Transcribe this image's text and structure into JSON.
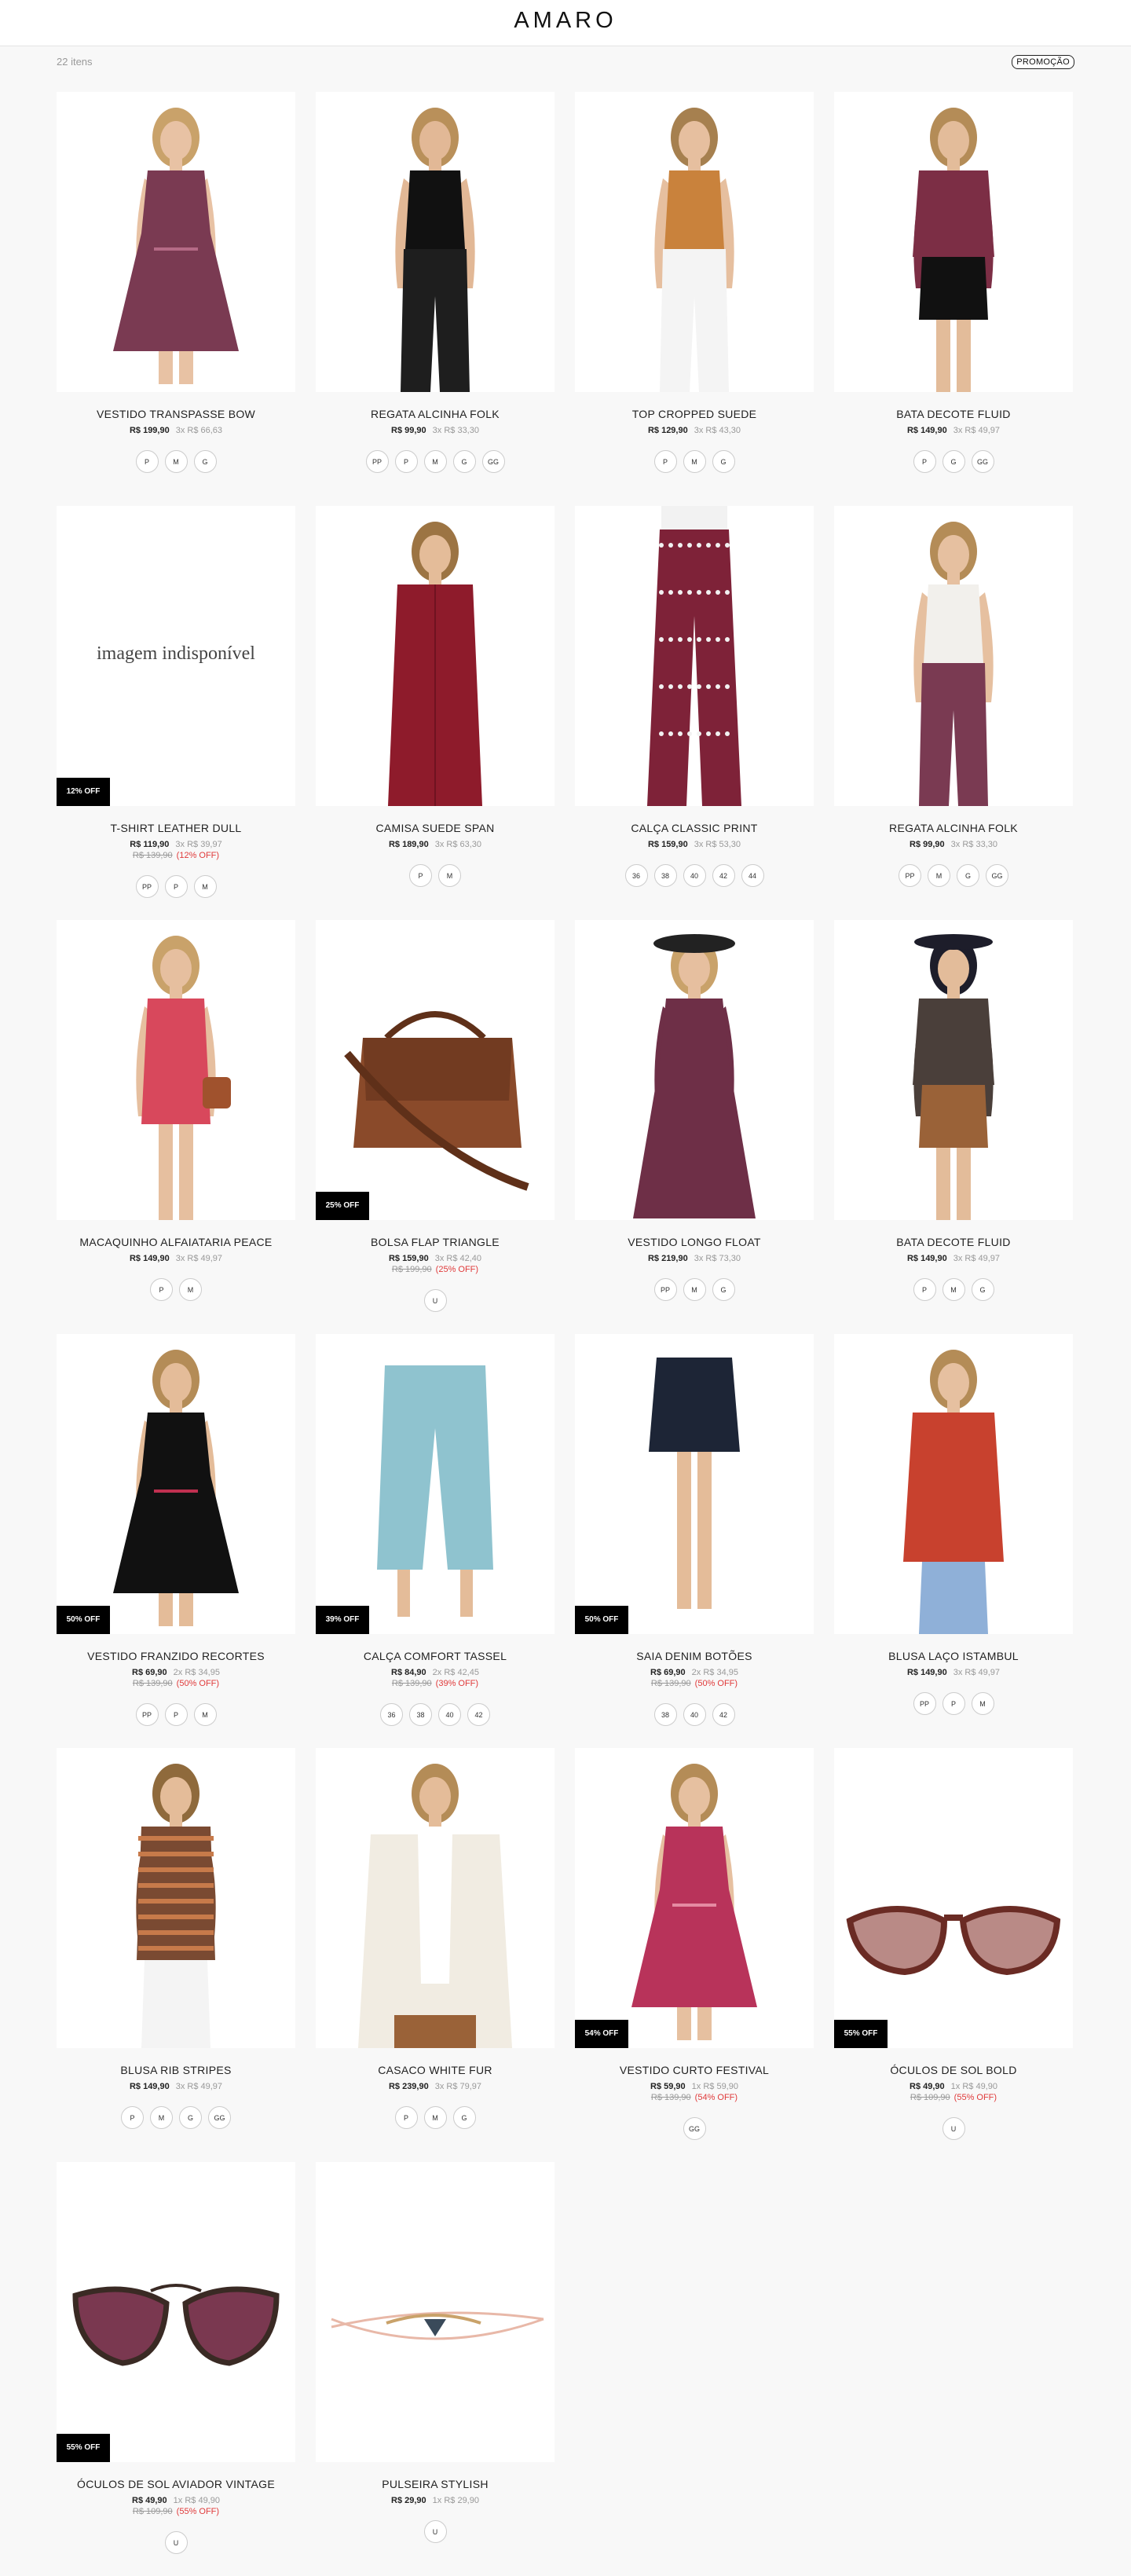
{
  "header": {
    "logo": "AMARO"
  },
  "toolbar": {
    "item_count": "22 itens",
    "filter_label": "PROMOÇÃO"
  },
  "products": [
    {
      "name": "VESTIDO TRANSPASSE BOW",
      "price": "R$ 199,90",
      "installments": "3x R$ 66,63",
      "old_price": "",
      "discount": "",
      "badge": "",
      "sizes": [
        "P",
        "M",
        "G"
      ],
      "unavailable": "",
      "visual": {
        "kind": "dress",
        "main": "#7a3a52",
        "accent": "#b56a86",
        "skin": "#e8c2a4",
        "hair": "#c9a26a"
      }
    },
    {
      "name": "REGATA ALCINHA FOLK",
      "price": "R$ 99,90",
      "installments": "3x R$ 33,30",
      "old_price": "",
      "discount": "",
      "badge": "",
      "sizes": [
        "PP",
        "P",
        "M",
        "G",
        "GG"
      ],
      "unavailable": "",
      "visual": {
        "kind": "top-pants",
        "main": "#111111",
        "accent": "#1e1e1e",
        "skin": "#e2b896",
        "hair": "#b9905a"
      }
    },
    {
      "name": "TOP CROPPED SUEDE",
      "price": "R$ 129,90",
      "installments": "3x R$ 43,30",
      "old_price": "",
      "discount": "",
      "badge": "",
      "sizes": [
        "P",
        "M",
        "G"
      ],
      "unavailable": "",
      "visual": {
        "kind": "top-pants",
        "main": "#c9823c",
        "accent": "#f4f4f4",
        "skin": "#e6bf9f",
        "hair": "#a6804f"
      }
    },
    {
      "name": "BATA DECOTE FLUID",
      "price": "R$ 149,90",
      "installments": "3x R$ 49,97",
      "old_price": "",
      "discount": "",
      "badge": "",
      "sizes": [
        "P",
        "G",
        "GG"
      ],
      "unavailable": "",
      "visual": {
        "kind": "blouse-shorts",
        "main": "#7c2e45",
        "accent": "#111111",
        "skin": "#e3bc9a",
        "hair": "#b48c57"
      }
    },
    {
      "name": "T-SHIRT LEATHER DULL",
      "price": "R$ 119,90",
      "installments": "3x R$ 39,97",
      "old_price": "R$ 139,90",
      "discount": "(12% OFF)",
      "badge": "12% OFF",
      "sizes": [
        "PP",
        "P",
        "M"
      ],
      "unavailable": "imagem indisponível",
      "visual": {
        "kind": "none",
        "main": "#ffffff",
        "accent": "#ffffff",
        "skin": "#ffffff",
        "hair": "#ffffff"
      }
    },
    {
      "name": "CAMISA SUEDE SPAN",
      "price": "R$ 189,90",
      "installments": "3x R$ 63,30",
      "old_price": "",
      "discount": "",
      "badge": "",
      "sizes": [
        "P",
        "M"
      ],
      "unavailable": "",
      "visual": {
        "kind": "shirt",
        "main": "#8e1b2b",
        "accent": "#6f1320",
        "skin": "#e4bc99",
        "hair": "#9c7443"
      }
    },
    {
      "name": "CALÇA CLASSIC PRINT",
      "price": "R$ 159,90",
      "installments": "3x R$ 53,30",
      "old_price": "",
      "discount": "",
      "badge": "",
      "sizes": [
        "36",
        "38",
        "40",
        "42",
        "44"
      ],
      "unavailable": "",
      "visual": {
        "kind": "pants",
        "main": "#7e2238",
        "accent": "#f2f2f2",
        "skin": "#e4bc99",
        "hair": "#9c7443"
      }
    },
    {
      "name": "REGATA ALCINHA FOLK",
      "price": "R$ 99,90",
      "installments": "3x R$ 33,30",
      "old_price": "",
      "discount": "",
      "badge": "",
      "sizes": [
        "PP",
        "M",
        "G",
        "GG"
      ],
      "unavailable": "",
      "visual": {
        "kind": "top-pants",
        "main": "#f2f0ec",
        "accent": "#7a3a52",
        "skin": "#e6c0a0",
        "hair": "#b48c57"
      }
    },
    {
      "name": "MACAQUINHO ALFAIATARIA PEACE",
      "price": "R$ 149,90",
      "installments": "3x R$ 49,97",
      "old_price": "",
      "discount": "",
      "badge": "",
      "sizes": [
        "P",
        "M"
      ],
      "unavailable": "",
      "visual": {
        "kind": "romper",
        "main": "#d8485c",
        "accent": "#a0522d",
        "skin": "#e6bf9f",
        "hair": "#c9a26a"
      }
    },
    {
      "name": "BOLSA FLAP TRIANGLE",
      "price": "R$ 159,90",
      "installments": "3x R$ 42,40",
      "old_price": "R$ 199,90",
      "discount": "(25% OFF)",
      "badge": "25% OFF",
      "sizes": [
        "U"
      ],
      "unavailable": "",
      "visual": {
        "kind": "bag",
        "main": "#8a4a2a",
        "accent": "#5f3019",
        "skin": "#000000",
        "hair": "#000000"
      }
    },
    {
      "name": "VESTIDO LONGO FLOAT",
      "price": "R$ 219,90",
      "installments": "3x R$ 73,30",
      "old_price": "",
      "discount": "",
      "badge": "",
      "sizes": [
        "PP",
        "M",
        "G"
      ],
      "unavailable": "",
      "visual": {
        "kind": "long-dress",
        "main": "#6e2f47",
        "accent": "#222222",
        "skin": "#e6bf9f",
        "hair": "#c9a26a"
      }
    },
    {
      "name": "BATA DECOTE FLUID",
      "price": "R$ 149,90",
      "installments": "3x R$ 49,97",
      "old_price": "",
      "discount": "",
      "badge": "",
      "sizes": [
        "P",
        "M",
        "G"
      ],
      "unavailable": "",
      "visual": {
        "kind": "blouse-shorts",
        "main": "#4a3f3a",
        "accent": "#9a6238",
        "skin": "#e3bc9a",
        "hair": "#1d1d2a"
      }
    },
    {
      "name": "VESTIDO FRANZIDO RECORTES",
      "price": "R$ 69,90",
      "installments": "2x R$ 34,95",
      "old_price": "R$ 139,90",
      "discount": "(50% OFF)",
      "badge": "50% OFF",
      "sizes": [
        "PP",
        "P",
        "M"
      ],
      "unavailable": "",
      "visual": {
        "kind": "dress",
        "main": "#111111",
        "accent": "#c03050",
        "skin": "#e4bc99",
        "hair": "#b48c57"
      }
    },
    {
      "name": "CALÇA COMFORT TASSEL",
      "price": "R$ 84,90",
      "installments": "2x R$ 42,45",
      "old_price": "R$ 139,90",
      "discount": "(39% OFF)",
      "badge": "39% OFF",
      "sizes": [
        "36",
        "38",
        "40",
        "42"
      ],
      "unavailable": "",
      "visual": {
        "kind": "legs-pants",
        "main": "#8fc3cf",
        "accent": "#ffffff",
        "skin": "#e4bc99",
        "hair": "#000000"
      }
    },
    {
      "name": "SAIA DENIM BOTÕES",
      "price": "R$ 69,90",
      "installments": "2x R$ 34,95",
      "old_price": "R$ 139,90",
      "discount": "(50% OFF)",
      "badge": "50% OFF",
      "sizes": [
        "38",
        "40",
        "42"
      ],
      "unavailable": "",
      "visual": {
        "kind": "skirt",
        "main": "#1d2536",
        "accent": "#ffffff",
        "skin": "#e4bc99",
        "hair": "#000000"
      }
    },
    {
      "name": "BLUSA LAÇO ISTAMBUL",
      "price": "R$ 149,90",
      "installments": "3x R$ 49,97",
      "old_price": "",
      "discount": "",
      "badge": "",
      "sizes": [
        "PP",
        "P",
        "M"
      ],
      "unavailable": "",
      "visual": {
        "kind": "blouse-jeans",
        "main": "#c8412e",
        "accent": "#8fb0d8",
        "skin": "#e6c0a0",
        "hair": "#b48c57"
      }
    },
    {
      "name": "BLUSA RIB STRIPES",
      "price": "R$ 149,90",
      "installments": "3x R$ 49,97",
      "old_price": "",
      "discount": "",
      "badge": "",
      "sizes": [
        "P",
        "M",
        "G",
        "GG"
      ],
      "unavailable": "",
      "visual": {
        "kind": "sweater",
        "main": "#7a4a32",
        "accent": "#f4f4f4",
        "skin": "#e4bc99",
        "hair": "#8f6a3c"
      }
    },
    {
      "name": "CASACO WHITE FUR",
      "price": "R$ 239,90",
      "installments": "3x R$ 79,97",
      "old_price": "",
      "discount": "",
      "badge": "",
      "sizes": [
        "P",
        "M",
        "G"
      ],
      "unavailable": "",
      "visual": {
        "kind": "fur",
        "main": "#f1ece2",
        "accent": "#9a6238",
        "skin": "#e4bc99",
        "hair": "#b48c57"
      }
    },
    {
      "name": "VESTIDO CURTO FESTIVAL",
      "price": "R$ 59,90",
      "installments": "1x R$ 59,90",
      "old_price": "R$ 139,90",
      "discount": "(54% OFF)",
      "badge": "54% OFF",
      "sizes": [
        "GG"
      ],
      "unavailable": "",
      "visual": {
        "kind": "dress",
        "main": "#b8335a",
        "accent": "#e58aa2",
        "skin": "#e6c0a0",
        "hair": "#b48c57"
      }
    },
    {
      "name": "ÓCULOS DE SOL BOLD",
      "price": "R$ 49,90",
      "installments": "1x R$ 49,90",
      "old_price": "R$ 109,90",
      "discount": "(55% OFF)",
      "badge": "55% OFF",
      "sizes": [
        "U"
      ],
      "unavailable": "",
      "visual": {
        "kind": "sunglasses-bold",
        "main": "#6a2b24",
        "accent": "#b98a86",
        "skin": "#000000",
        "hair": "#000000"
      }
    },
    {
      "name": "ÓCULOS DE SOL AVIADOR VINTAGE",
      "price": "R$ 49,90",
      "installments": "1x R$ 49,90",
      "old_price": "R$ 109,90",
      "discount": "(55% OFF)",
      "badge": "55% OFF",
      "sizes": [
        "U"
      ],
      "unavailable": "",
      "visual": {
        "kind": "sunglasses-aviator",
        "main": "#3a2a24",
        "accent": "#7a3850",
        "skin": "#000000",
        "hair": "#000000"
      }
    },
    {
      "name": "PULSEIRA STYLISH",
      "price": "R$ 29,90",
      "installments": "1x R$ 29,90",
      "old_price": "",
      "discount": "",
      "badge": "",
      "sizes": [
        "U"
      ],
      "unavailable": "",
      "visual": {
        "kind": "bracelet",
        "main": "#c9a26a",
        "accent": "#3a4a5a",
        "skin": "#e8b8a8",
        "hair": "#000000"
      }
    }
  ]
}
